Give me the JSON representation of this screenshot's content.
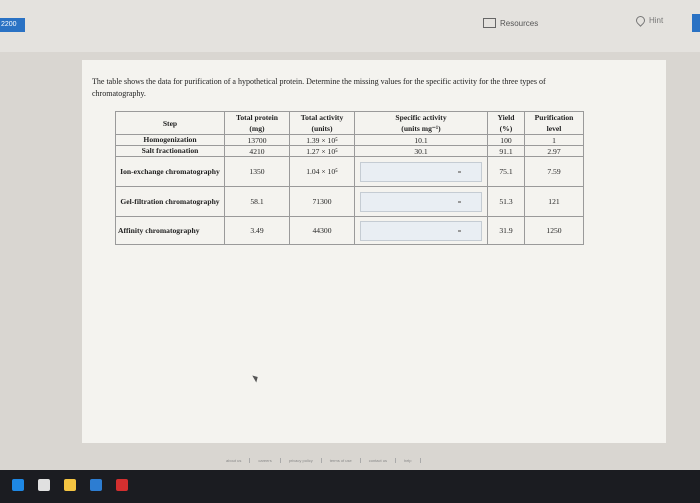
{
  "header": {
    "score_label": "2200",
    "resources_label": "Resources",
    "hint_label": "Hint"
  },
  "question": {
    "text": "The table shows the data for purification of a hypothetical protein. Determine the missing values for the specific activity for the three types of chromatography."
  },
  "table": {
    "headers": {
      "step": "Step",
      "total_protein": "Total protein",
      "total_protein_unit": "(mg)",
      "total_activity": "Total activity",
      "total_activity_unit": "(units)",
      "specific_activity": "Specific activity",
      "specific_activity_unit": "(units mg⁻¹)",
      "yield": "Yield",
      "yield_unit": "(%)",
      "purification": "Purification",
      "purification_unit": "level"
    },
    "rows": [
      {
        "step": "Homogenization",
        "protein": "13700",
        "activity": "1.39 × 10⁵",
        "specific": "10.1",
        "yield": "100",
        "purification": "1"
      },
      {
        "step": "Salt fractionation",
        "protein": "4210",
        "activity": "1.27 × 10⁵",
        "specific": "30.1",
        "yield": "91.1",
        "purification": "2.97"
      },
      {
        "step": "Ion-exchange chromatography",
        "protein": "1350",
        "activity": "1.04 × 10⁵",
        "specific": "",
        "yield": "75.1",
        "purification": "7.59"
      },
      {
        "step": "Gel-filtration chromatography",
        "protein": "58.1",
        "activity": "71300",
        "specific": "",
        "yield": "51.3",
        "purification": "121"
      },
      {
        "step": "Affinity chromatography",
        "protein": "3.49",
        "activity": "44300",
        "specific": "",
        "yield": "31.9",
        "purification": "1250"
      }
    ]
  },
  "footer": {
    "links": [
      "about us",
      "careers",
      "privacy policy",
      "terms of use",
      "contact us",
      "help"
    ]
  },
  "colors": {
    "accent": "#2a72c4",
    "taskbar": "#1b1c21"
  }
}
